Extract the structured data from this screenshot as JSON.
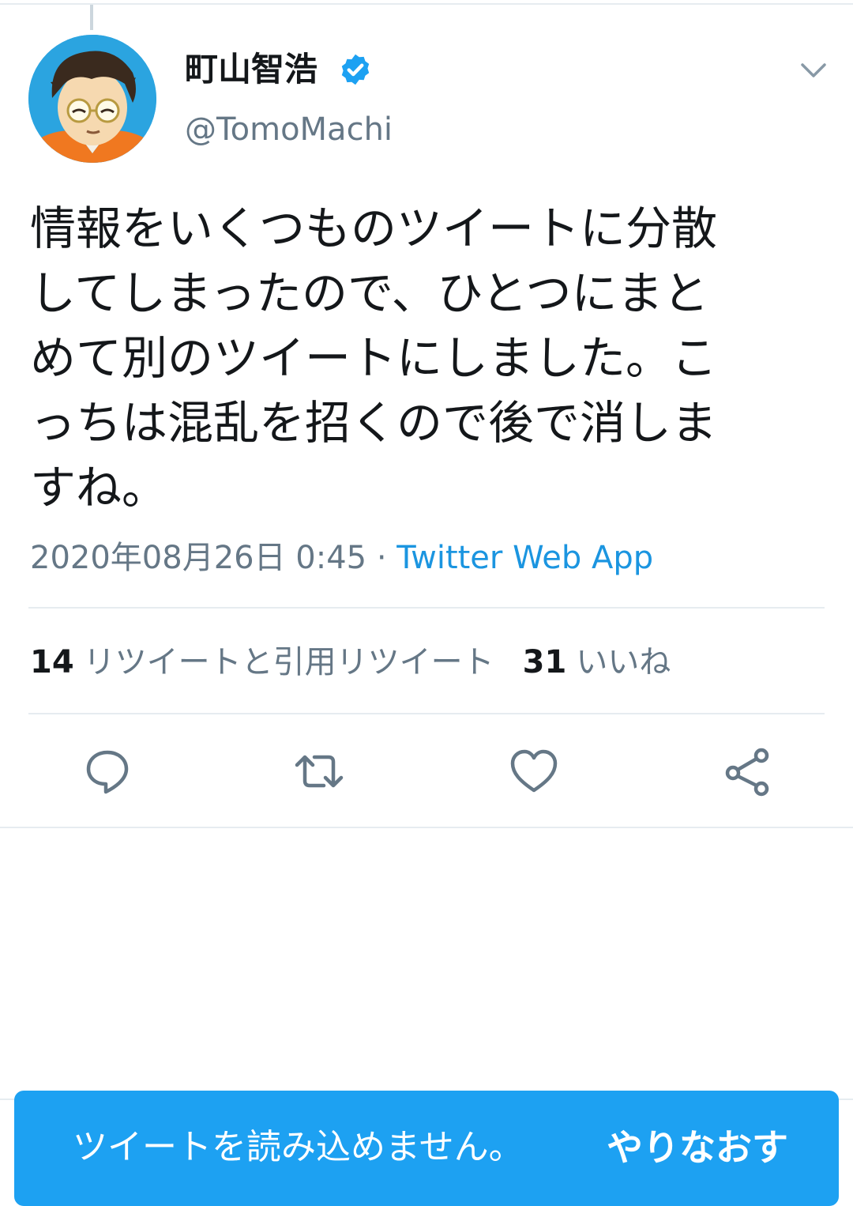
{
  "user": {
    "display_name": "町山智浩",
    "handle": "@TomoMachi",
    "verified": true,
    "avatar_icon": "cartoon-portrait-avatar"
  },
  "tweet": {
    "text": "情報をいくつものツイートに分散\nしてしまったので、ひとつにまと\nめて別のツイートにしました。こ\nっちは混乱を招くので後で消しま\nすね。",
    "timestamp": "2020年08月26日 0:45",
    "separator": " · ",
    "source": "Twitter Web App"
  },
  "stats": {
    "retweets_count": "14",
    "retweets_label": "リツイートと引用リツイート",
    "likes_count": "31",
    "likes_label": "いいね"
  },
  "actions": [
    "reply-icon",
    "retweet-icon",
    "like-icon",
    "share-icon"
  ],
  "error_bar": {
    "message": "ツイートを読み込めません。",
    "retry_label": "やりなおす"
  },
  "colors": {
    "accent": "#1da1f2",
    "link": "#1b95e0",
    "muted": "#657786",
    "text": "#14171a"
  }
}
